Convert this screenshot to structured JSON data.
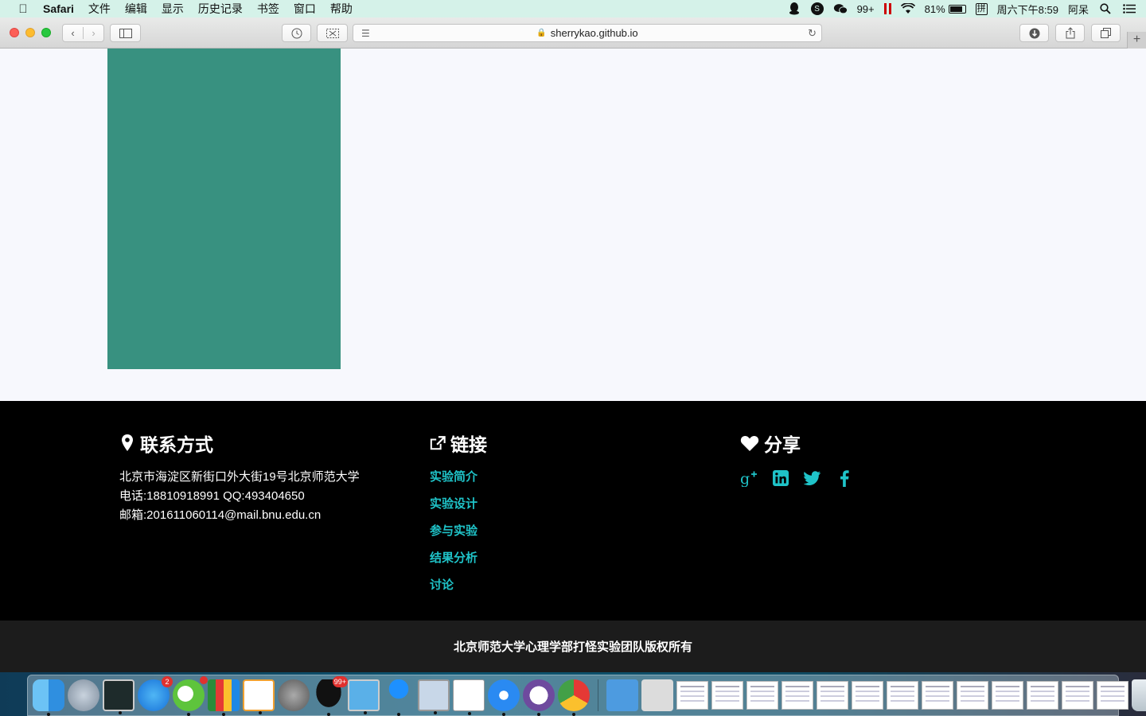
{
  "menubar": {
    "app_name": "Safari",
    "items": [
      "文件",
      "编辑",
      "显示",
      "历史记录",
      "书签",
      "窗口",
      "帮助"
    ],
    "notification_count": "99+",
    "battery_percent": "81%",
    "input_method": "拼",
    "clock": "周六下午8:59",
    "user": "阿呆"
  },
  "browser": {
    "url": "sherrykao.github.io"
  },
  "footer": {
    "contact": {
      "title": "联系方式",
      "address": "北京市海淀区新街口外大街19号北京师范大学",
      "phone": "电话:18810918991 QQ:493404650",
      "email": "邮箱:201611060114@mail.bnu.edu.cn"
    },
    "links": {
      "title": "链接",
      "items": [
        "实验简介",
        "实验设计",
        "参与实验",
        "结果分析",
        "讨论"
      ]
    },
    "share": {
      "title": "分享",
      "icons": [
        "google-plus-icon",
        "linkedin-icon",
        "twitter-icon",
        "facebook-icon"
      ]
    },
    "copyright": "北京师范大学心理学部打怪实验团队版权所有"
  },
  "colors": {
    "accent": "#1fc3c8",
    "block": "#389180",
    "footer_bg": "#000000",
    "copyright_bg": "#1c1c1c"
  },
  "dock": {
    "appstore_badge": "2",
    "qq_badge": "99+"
  }
}
